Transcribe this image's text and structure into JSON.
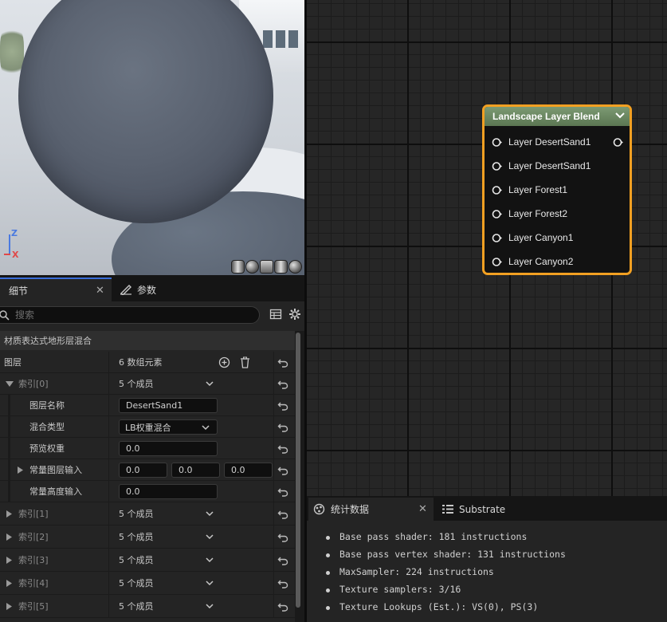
{
  "viewport": {
    "axis_z": "Z",
    "axis_x": "X",
    "preview_shapes": [
      "cylinder-icon",
      "sphere-icon",
      "plane-icon",
      "cube-icon",
      "teapot-icon"
    ]
  },
  "details": {
    "tabs": [
      {
        "label": "细节",
        "icon": "details-icon",
        "active": true,
        "closable": true
      },
      {
        "label": "参数",
        "icon": "parameters-icon",
        "active": false
      }
    ],
    "search_placeholder": "搜索",
    "section_title": "材质表达式地形层混合",
    "layers_row": {
      "name": "图层",
      "value": "6 数组元素"
    },
    "index0": {
      "name": "索引[0]",
      "value": "5 个成员",
      "children": {
        "layer_name": {
          "name": "图层名称",
          "value": "DesertSand1"
        },
        "blend_type": {
          "name": "混合类型",
          "value": "LB权重混合"
        },
        "preview_weight": {
          "name": "预览权重",
          "value": "0.0"
        },
        "const_layer_input": {
          "name": "常量图层输入",
          "values": [
            "0.0",
            "0.0",
            "0.0"
          ]
        },
        "const_height_input": {
          "name": "常量高度输入",
          "value": "0.0"
        }
      }
    },
    "indices": [
      {
        "name": "索引[1]",
        "value": "5 个成员"
      },
      {
        "name": "索引[2]",
        "value": "5 个成员"
      },
      {
        "name": "索引[3]",
        "value": "5 个成员"
      },
      {
        "name": "索引[4]",
        "value": "5 个成员"
      },
      {
        "name": "索引[5]",
        "value": "5 个成员"
      }
    ]
  },
  "graph": {
    "node": {
      "title": "Landscape Layer Blend",
      "header_color": "#6b8762",
      "selected_border": "#f2a022",
      "inputs": [
        "Layer DesertSand1",
        "Layer DesertSand1",
        "Layer Forest1",
        "Layer Forest2",
        "Layer Canyon1",
        "Layer Canyon2"
      ]
    }
  },
  "stats": {
    "tabs": [
      {
        "label": "统计数据",
        "icon": "stats-icon",
        "active": true,
        "closable": true
      },
      {
        "label": "Substrate",
        "icon": "list-icon",
        "active": false
      }
    ],
    "lines": [
      "Base pass shader: 181 instructions",
      "Base pass vertex shader: 131 instructions",
      "MaxSampler: 224 instructions",
      "Texture samplers: 3/16",
      "Texture Lookups (Est.): VS(0), PS(3)"
    ]
  }
}
